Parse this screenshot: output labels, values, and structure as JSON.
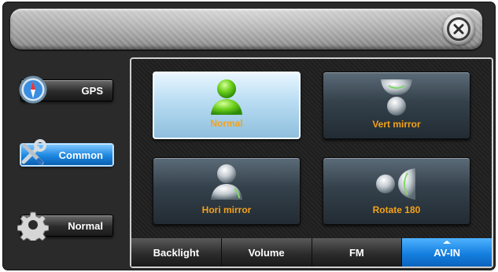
{
  "header": {
    "close_icon": "close-icon"
  },
  "sidebar": {
    "items": [
      {
        "label": "GPS",
        "icon": "compass-icon",
        "active": false
      },
      {
        "label": "Common",
        "icon": "tools-icon",
        "active": true
      },
      {
        "label": "Normal",
        "icon": "gear-icon",
        "active": false
      }
    ]
  },
  "panel": {
    "options": [
      {
        "label": "Normal",
        "icon": "user-normal-icon",
        "selected": true
      },
      {
        "label": "Vert mirror",
        "icon": "user-vert-mirror-icon",
        "selected": false
      },
      {
        "label": "Hori mirror",
        "icon": "user-hori-mirror-icon",
        "selected": false
      },
      {
        "label": "Rotate 180",
        "icon": "user-rotate-icon",
        "selected": false
      }
    ]
  },
  "tabs": [
    {
      "label": "Backlight",
      "active": false
    },
    {
      "label": "Volume",
      "active": false
    },
    {
      "label": "FM",
      "active": false
    },
    {
      "label": "AV-IN",
      "active": true
    }
  ],
  "colors": {
    "accent": "#1c86e0",
    "label": "#f3a21a",
    "selected_icon": "#5fce1a"
  }
}
